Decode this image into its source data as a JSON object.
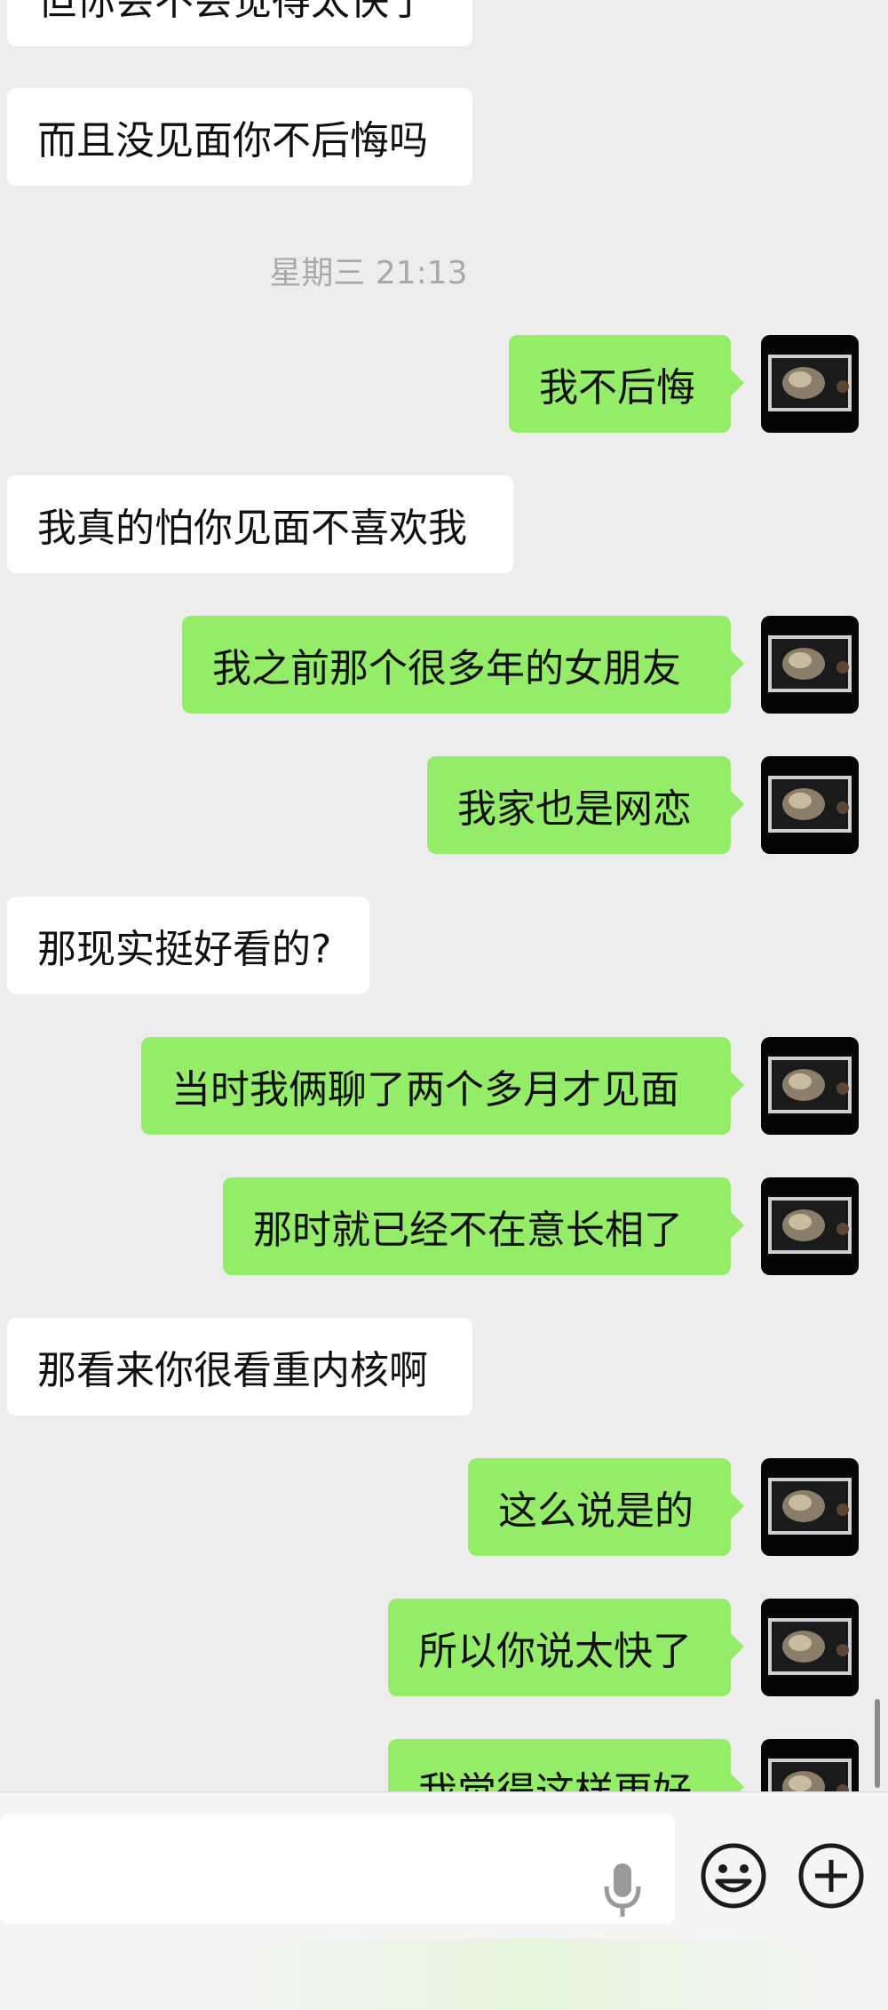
{
  "conversation": {
    "timestamp": "星期三 21:13",
    "messages": [
      {
        "side": "in",
        "text": "但你会不会觉得太快了"
      },
      {
        "side": "in",
        "text": "而且没见面你不后悔吗"
      },
      {
        "side": "out",
        "text": "我不后悔"
      },
      {
        "side": "in",
        "text": "我真的怕你见面不喜欢我"
      },
      {
        "side": "out",
        "text": "我之前那个很多年的女朋友"
      },
      {
        "side": "out",
        "text": "我家也是网恋"
      },
      {
        "side": "in",
        "text": "那现实挺好看的?"
      },
      {
        "side": "out",
        "text": "当时我俩聊了两个多月才见面"
      },
      {
        "side": "out",
        "text": "那时就已经不在意长相了"
      },
      {
        "side": "in",
        "text": "那看来你很看重内核啊"
      },
      {
        "side": "out",
        "text": "这么说是的"
      },
      {
        "side": "out",
        "text": "所以你说太快了"
      },
      {
        "side": "out",
        "text": "我觉得这样更好"
      }
    ]
  },
  "input_bar": {
    "input_value": "",
    "icons": [
      "voice-icon",
      "emoji-icon",
      "plus-icon"
    ]
  },
  "colors": {
    "chat_background": "#ededed",
    "incoming_bubble": "#ffffff",
    "outgoing_bubble": "#95ec69"
  }
}
